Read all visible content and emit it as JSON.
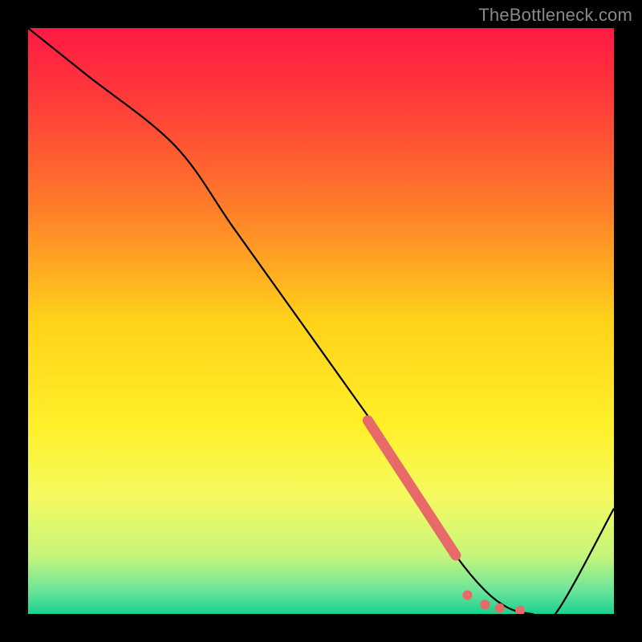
{
  "watermark": "TheBottleneck.com",
  "chart_data": {
    "type": "line",
    "title": "",
    "xlabel": "",
    "ylabel": "",
    "xlim": [
      0,
      100
    ],
    "ylim": [
      0,
      100
    ],
    "grid": false,
    "legend": false,
    "gradient_stops": [
      {
        "offset": 0,
        "color": "#ff1a44"
      },
      {
        "offset": 12,
        "color": "#ff3a3a"
      },
      {
        "offset": 30,
        "color": "#ff7a2a"
      },
      {
        "offset": 50,
        "color": "#ffd21a"
      },
      {
        "offset": 68,
        "color": "#fff02a"
      },
      {
        "offset": 80,
        "color": "#f4fa60"
      },
      {
        "offset": 90,
        "color": "#c7f57a"
      },
      {
        "offset": 96,
        "color": "#6be59a"
      },
      {
        "offset": 100,
        "color": "#1ad18f"
      }
    ],
    "curve": {
      "name": "bottleneck-curve",
      "x": [
        0,
        10,
        25,
        35,
        45,
        55,
        62,
        68,
        73,
        78,
        82,
        86,
        90,
        100
      ],
      "y": [
        100,
        92,
        80,
        66,
        52,
        38,
        28,
        18,
        10,
        4,
        1,
        0,
        0,
        18
      ]
    },
    "highlight_segment": {
      "name": "salmon-bar",
      "color": "#e86a68",
      "x": [
        58,
        73
      ],
      "y": [
        33,
        10
      ]
    },
    "dots": {
      "color": "#e86a68",
      "points": [
        {
          "x": 75,
          "y": 3.2
        },
        {
          "x": 78,
          "y": 1.6
        },
        {
          "x": 80.5,
          "y": 1.0
        },
        {
          "x": 84,
          "y": 0.6
        }
      ]
    }
  }
}
